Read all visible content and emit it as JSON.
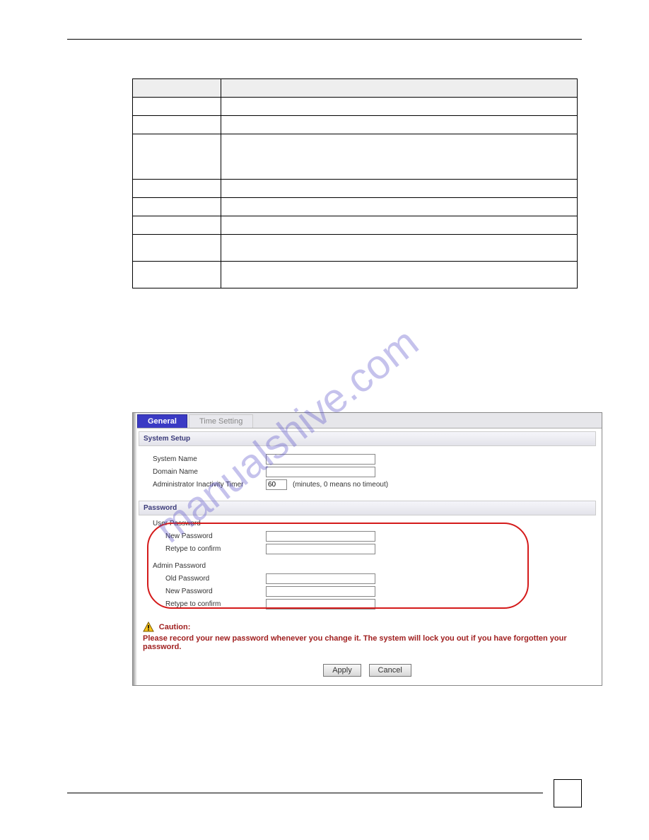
{
  "tabs": {
    "general": "General",
    "time": "Time Setting"
  },
  "sections": {
    "system_setup": "System Setup",
    "password": "Password"
  },
  "labels": {
    "system_name": "System Name",
    "domain_name": "Domain Name",
    "inactivity_timer": "Administrator Inactivity Timer",
    "inactivity_hint": "(minutes, 0 means no timeout)",
    "user_password": "User Password",
    "admin_password": "Admin Password",
    "new_password": "New Password",
    "retype": "Retype to confirm",
    "old_password": "Old Password"
  },
  "values": {
    "inactivity_timer": "60"
  },
  "caution": {
    "title": "Caution:",
    "text": "Please record your new password whenever you change it. The system will lock you out if you have forgotten your password."
  },
  "buttons": {
    "apply": "Apply",
    "cancel": "Cancel"
  },
  "watermark": "manualshive.com"
}
